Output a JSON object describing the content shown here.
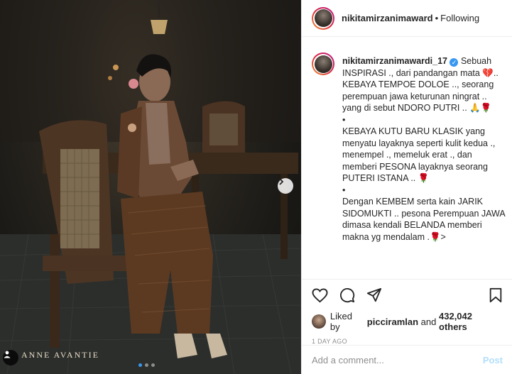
{
  "photo": {
    "watermark": "ANNE AVANTIE",
    "next_icon": "chevron-right-icon",
    "tag_icon": "user-tag-icon",
    "carousel_dots": [
      true,
      false,
      false
    ]
  },
  "header": {
    "username": "nikitamirzanimaward",
    "separator": "•",
    "follow_status": "Following"
  },
  "caption": {
    "username": "nikitamirzanimawardi_17",
    "verified_mark": "✓",
    "paragraphs": [
      "Sebuah INSPIRASI ., dari pandangan mata 💔.. KEBAYA TEMPOE DOLOE .., seorang perempuan jawa keturunan ningrat .. yang di sebut NDORO PUTRI .. 🙏🌹",
      "•",
      "KEBAYA KUTU BARU KLASIK yang menyatu layaknya seperti kulit kedua ., menempel ., memeluk erat ., dan memberi PESONA layaknya seorang PUTERI ISTANA .. 🌹",
      "•",
      "Dengan KEMBEM serta kain JARIK SIDOMUKTI .. pesona Perempuan JAWA dimasa kendali BELANDA memberi makna yg mendalam .🌹>"
    ]
  },
  "actions": {
    "like_icon": "heart-icon",
    "comment_icon": "comment-icon",
    "share_icon": "share-icon",
    "save_icon": "bookmark-icon"
  },
  "likes": {
    "prefix": "Liked by",
    "user": "picciramlan",
    "middle": "and",
    "count": "432,042 others"
  },
  "timestamp": "1 DAY AGO",
  "comment": {
    "placeholder": "Add a comment...",
    "post_label": "Post"
  }
}
